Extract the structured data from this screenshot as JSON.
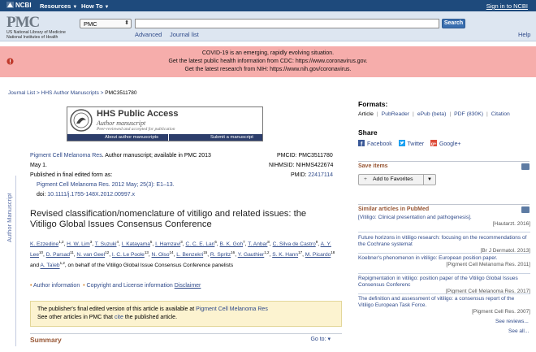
{
  "ncbi": {
    "logo": "NCBI",
    "menu_resources": "Resources",
    "menu_howto": "How To",
    "signin": "Sign in to NCBI"
  },
  "header": {
    "logo_text": "PMC",
    "logo_sub1": "US National Library of Medicine",
    "logo_sub2": "National Institutes of Health",
    "db_selected": "PMC",
    "search_value": "",
    "search_button": "Search",
    "advanced": "Advanced",
    "journal_list": "Journal list",
    "help": "Help"
  },
  "alert": {
    "line1": "COVID-19 is an emerging, rapidly evolving situation.",
    "line2_prefix": "Get the latest public health information from CDC:",
    "line2_link": "https://www.coronavirus.gov",
    "line2_suffix": ".",
    "line3_prefix": "Get the latest research from NIH:",
    "line3_link": "https://www.nih.gov/coronavirus",
    "line3_suffix": "."
  },
  "breadcrumb": {
    "item1": "Journal List",
    "item2": "HHS Author Manuscripts",
    "current": "PMC3511780"
  },
  "hhs": {
    "title": "HHS Public Access",
    "subtitle": "Author manuscript",
    "note": "Peer-reviewed and accepted for publication",
    "about": "About author manuscripts",
    "submit": "Submit a manuscript"
  },
  "side_label": "Author Manuscript",
  "article": {
    "journal": "Pigment Cell Melanoma Res",
    "availability": ". Author manuscript; available in PMC 2013",
    "date": "May 1.",
    "final_form": "Published in final edited form as:",
    "citation": "Pigment Cell Melanoma Res. 2012 May; 25(3): E1–13.",
    "doi_label": "doi: ",
    "doi": "10.1111/j.1755-148X.2012.00997.x",
    "pmcid": "PMCID: PMC3511780",
    "nihmsid": "NIHMSID: NIHMS422674",
    "pmid_label": "PMID: ",
    "pmid": "22417114",
    "title": "Revised classification/nomenclature of vitiligo and related issues: the Vitiligo Global Issues Consensus Conference",
    "consortium": ", on behalf of the Vitiligo Global Issue Consensus Conference panelists",
    "author_info": "Author information",
    "copyright": "Copyright and License information",
    "disclaimer": "Disclaimer",
    "notice_prefix": "The publisher's final edited version of this article is available at",
    "notice_link": "Pigment Cell Melanoma Res",
    "notice2_prefix": "See other articles in PMC that",
    "notice2_link": "cite",
    "notice2_suffix": "the published article.",
    "summary": "Summary",
    "goto": "Go to:"
  },
  "authors": [
    {
      "name": "K. Ezzedine",
      "sup": "1,2"
    },
    {
      "name": "H. W. Lim",
      "sup": "3"
    },
    {
      "name": "T. Suzuki",
      "sup": "4"
    },
    {
      "name": "I. Katayama",
      "sup": "5"
    },
    {
      "name": "I. Hamzavi",
      "sup": "3"
    },
    {
      "name": "C. C. E. Lan",
      "sup": "6"
    },
    {
      "name": "B. K. Goh",
      "sup": "7"
    },
    {
      "name": "T. Anbar",
      "sup": "8"
    },
    {
      "name": "C. Silva de Castro",
      "sup": "9"
    },
    {
      "name": "A. Y. Lee",
      "sup": "10"
    },
    {
      "name": "D. Parsad",
      "sup": "11"
    },
    {
      "name": "N. van Geel",
      "sup": "12"
    },
    {
      "name": "I. C. Le Poole",
      "sup": "13"
    },
    {
      "name": "N. Oiso",
      "sup": "14"
    },
    {
      "name": "L. Benzekri",
      "sup": "15"
    },
    {
      "name": "R. Spritz",
      "sup": "16"
    },
    {
      "name": "Y. Gauthier",
      "sup": "1,2"
    },
    {
      "name": "S. K. Hann",
      "sup": "17"
    },
    {
      "name": "M. Picardo",
      "sup": "18"
    },
    {
      "name": "A. Taïeb",
      "sup": "1,2"
    }
  ],
  "formats": {
    "heading": "Formats:",
    "items": [
      "Article",
      "PubReader",
      "ePub (beta)",
      "PDF (830K)",
      "Citation"
    ]
  },
  "share": {
    "heading": "Share",
    "facebook": "Facebook",
    "twitter": "Twitter",
    "google": "Google+"
  },
  "save": {
    "heading": "Save items",
    "button": "Add to Favorites"
  },
  "similar": {
    "heading": "Similar articles in PubMed",
    "items": [
      {
        "title": "[Vitiligo: Clinical presentation and pathogenesis].",
        "source": "[Hautarzt. 2016]"
      },
      {
        "title": "Future horizons in vitiligo research: focusing on the recommendations of the Cochrane systemat",
        "source": "[Br J Dermatol. 2013]"
      },
      {
        "title": "Koebner's phenomenon in vitiligo: European position paper.",
        "source": "[Pigment Cell Melanoma Res. 2011]"
      },
      {
        "title": "Repigmentation in vitiligo: position paper of the Vitiligo Global Issues Consensus Conferenc",
        "source": "[Pigment Cell Melanoma Res. 2017]"
      },
      {
        "title": "The definition and assessment of vitiligo: a consensus report of the Vitiligo European Task Force.",
        "source": "[Pigment Cell Res. 2007]"
      }
    ],
    "see_reviews": "See reviews...",
    "see_all": "See all..."
  }
}
